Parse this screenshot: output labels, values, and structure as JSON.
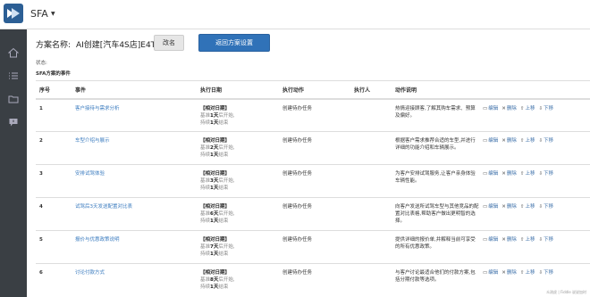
{
  "app": {
    "name": "SFA"
  },
  "plan": {
    "label": "方案名称:",
    "name": "AI创建[汽车4S店]E4Tj",
    "rename_label": "改名",
    "back_label": "返回方案设置",
    "status_label": "状态:",
    "section_title": "SFA方案的事件"
  },
  "table": {
    "headers": [
      "序号",
      "事件",
      "执行日期",
      "执行动作",
      "执行人",
      "动作说明",
      ""
    ],
    "rows": [
      {
        "idx": "1",
        "event": "客户接待与需求分析",
        "date_title": "【相对日期】",
        "start_prefix": "基准",
        "start_num": "1天",
        "start_suffix": "后开始,",
        "dur_prefix": "持续",
        "dur_num": "1天",
        "dur_suffix": "结束",
        "action": "创建待办任务",
        "executor": "",
        "desc": "热情迎接顾客,了解其购车需求、预算及偏好。"
      },
      {
        "idx": "2",
        "event": "车型介绍与展示",
        "date_title": "【相对日期】",
        "start_prefix": "基准",
        "start_num": "2天",
        "start_suffix": "后开始,",
        "dur_prefix": "持续",
        "dur_num": "1天",
        "dur_suffix": "结束",
        "action": "创建待办任务",
        "executor": "",
        "desc": "根据客户需求推荐合适的车型,并进行详细的功能介绍和车辆展示。"
      },
      {
        "idx": "3",
        "event": "安排试驾体验",
        "date_title": "【相对日期】",
        "start_prefix": "基准",
        "start_num": "3天",
        "start_suffix": "后开始,",
        "dur_prefix": "持续",
        "dur_num": "1天",
        "dur_suffix": "结束",
        "action": "创建待办任务",
        "executor": "",
        "desc": "为客户安排试驾服务,让客户亲身体验车辆性能。"
      },
      {
        "idx": "4",
        "event": "试驾后3天发送配置对比表",
        "date_title": "【相对日期】",
        "start_prefix": "基准",
        "start_num": "6天",
        "start_suffix": "后开始,",
        "dur_prefix": "持续",
        "dur_num": "1天",
        "dur_suffix": "结束",
        "action": "创建待办任务",
        "executor": "",
        "desc": "向客户发送所试驾车型与其他竞品的配置对比表格,帮助客户做出更明智的选择。"
      },
      {
        "idx": "5",
        "event": "报价与优惠政策说明",
        "date_title": "【相对日期】",
        "start_prefix": "基准",
        "start_num": "7天",
        "start_suffix": "后开始,",
        "dur_prefix": "持续",
        "dur_num": "1天",
        "dur_suffix": "结束",
        "action": "创建待办任务",
        "executor": "",
        "desc": "提供详细的报价单,并解释当前可享受的所有优惠政策。"
      },
      {
        "idx": "6",
        "event": "讨论付款方式",
        "date_title": "【相对日期】",
        "start_prefix": "基准",
        "start_num": "8天",
        "start_suffix": "后开始,",
        "dur_prefix": "持续",
        "dur_num": "1天",
        "dur_suffix": "结束",
        "action": "创建待办任务",
        "executor": "",
        "desc": "与客户讨论最适合他们的付款方案,包括分期付款等选项。"
      }
    ],
    "ops": {
      "edit": "编辑",
      "delete": "删除",
      "up": "上移",
      "down": "下移"
    }
  },
  "icons": [
    "logo-icon",
    "home-icon",
    "list-icon",
    "folder-icon",
    "comment-icon",
    "caret-down-icon"
  ],
  "colors": {
    "primary": "#3072b8",
    "sidebar": "#3a3f44",
    "link": "#3a7bbf"
  },
  "watermark": "众测虎 | Fiddle 说说加时"
}
